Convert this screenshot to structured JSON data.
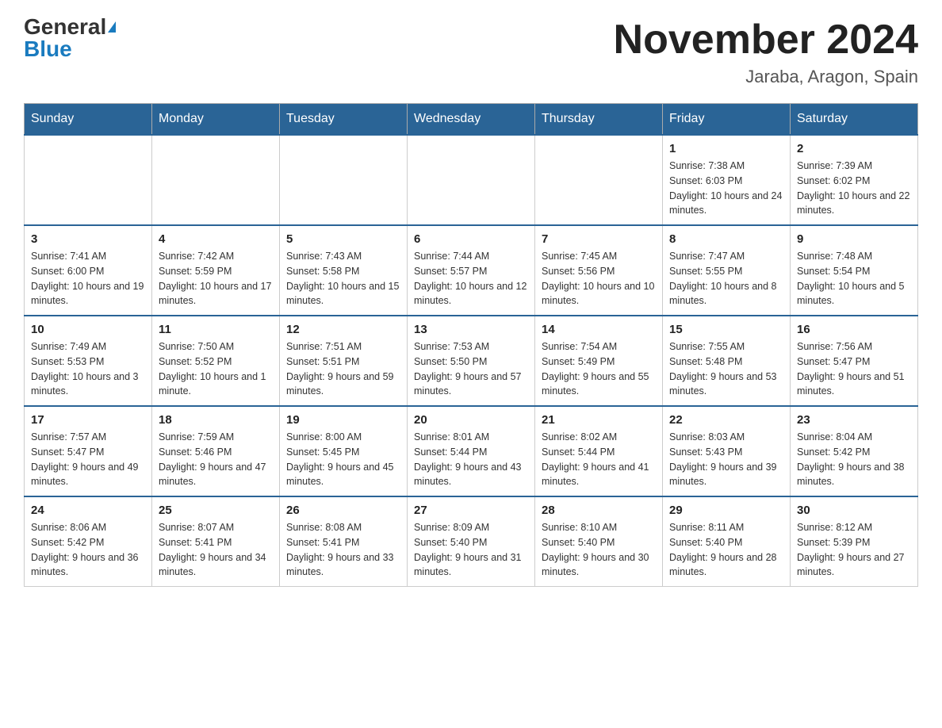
{
  "logo": {
    "general": "General",
    "blue": "Blue"
  },
  "title": "November 2024",
  "subtitle": "Jaraba, Aragon, Spain",
  "days_of_week": [
    "Sunday",
    "Monday",
    "Tuesday",
    "Wednesday",
    "Thursday",
    "Friday",
    "Saturday"
  ],
  "weeks": [
    [
      {
        "day": "",
        "info": ""
      },
      {
        "day": "",
        "info": ""
      },
      {
        "day": "",
        "info": ""
      },
      {
        "day": "",
        "info": ""
      },
      {
        "day": "",
        "info": ""
      },
      {
        "day": "1",
        "info": "Sunrise: 7:38 AM\nSunset: 6:03 PM\nDaylight: 10 hours and 24 minutes."
      },
      {
        "day": "2",
        "info": "Sunrise: 7:39 AM\nSunset: 6:02 PM\nDaylight: 10 hours and 22 minutes."
      }
    ],
    [
      {
        "day": "3",
        "info": "Sunrise: 7:41 AM\nSunset: 6:00 PM\nDaylight: 10 hours and 19 minutes."
      },
      {
        "day": "4",
        "info": "Sunrise: 7:42 AM\nSunset: 5:59 PM\nDaylight: 10 hours and 17 minutes."
      },
      {
        "day": "5",
        "info": "Sunrise: 7:43 AM\nSunset: 5:58 PM\nDaylight: 10 hours and 15 minutes."
      },
      {
        "day": "6",
        "info": "Sunrise: 7:44 AM\nSunset: 5:57 PM\nDaylight: 10 hours and 12 minutes."
      },
      {
        "day": "7",
        "info": "Sunrise: 7:45 AM\nSunset: 5:56 PM\nDaylight: 10 hours and 10 minutes."
      },
      {
        "day": "8",
        "info": "Sunrise: 7:47 AM\nSunset: 5:55 PM\nDaylight: 10 hours and 8 minutes."
      },
      {
        "day": "9",
        "info": "Sunrise: 7:48 AM\nSunset: 5:54 PM\nDaylight: 10 hours and 5 minutes."
      }
    ],
    [
      {
        "day": "10",
        "info": "Sunrise: 7:49 AM\nSunset: 5:53 PM\nDaylight: 10 hours and 3 minutes."
      },
      {
        "day": "11",
        "info": "Sunrise: 7:50 AM\nSunset: 5:52 PM\nDaylight: 10 hours and 1 minute."
      },
      {
        "day": "12",
        "info": "Sunrise: 7:51 AM\nSunset: 5:51 PM\nDaylight: 9 hours and 59 minutes."
      },
      {
        "day": "13",
        "info": "Sunrise: 7:53 AM\nSunset: 5:50 PM\nDaylight: 9 hours and 57 minutes."
      },
      {
        "day": "14",
        "info": "Sunrise: 7:54 AM\nSunset: 5:49 PM\nDaylight: 9 hours and 55 minutes."
      },
      {
        "day": "15",
        "info": "Sunrise: 7:55 AM\nSunset: 5:48 PM\nDaylight: 9 hours and 53 minutes."
      },
      {
        "day": "16",
        "info": "Sunrise: 7:56 AM\nSunset: 5:47 PM\nDaylight: 9 hours and 51 minutes."
      }
    ],
    [
      {
        "day": "17",
        "info": "Sunrise: 7:57 AM\nSunset: 5:47 PM\nDaylight: 9 hours and 49 minutes."
      },
      {
        "day": "18",
        "info": "Sunrise: 7:59 AM\nSunset: 5:46 PM\nDaylight: 9 hours and 47 minutes."
      },
      {
        "day": "19",
        "info": "Sunrise: 8:00 AM\nSunset: 5:45 PM\nDaylight: 9 hours and 45 minutes."
      },
      {
        "day": "20",
        "info": "Sunrise: 8:01 AM\nSunset: 5:44 PM\nDaylight: 9 hours and 43 minutes."
      },
      {
        "day": "21",
        "info": "Sunrise: 8:02 AM\nSunset: 5:44 PM\nDaylight: 9 hours and 41 minutes."
      },
      {
        "day": "22",
        "info": "Sunrise: 8:03 AM\nSunset: 5:43 PM\nDaylight: 9 hours and 39 minutes."
      },
      {
        "day": "23",
        "info": "Sunrise: 8:04 AM\nSunset: 5:42 PM\nDaylight: 9 hours and 38 minutes."
      }
    ],
    [
      {
        "day": "24",
        "info": "Sunrise: 8:06 AM\nSunset: 5:42 PM\nDaylight: 9 hours and 36 minutes."
      },
      {
        "day": "25",
        "info": "Sunrise: 8:07 AM\nSunset: 5:41 PM\nDaylight: 9 hours and 34 minutes."
      },
      {
        "day": "26",
        "info": "Sunrise: 8:08 AM\nSunset: 5:41 PM\nDaylight: 9 hours and 33 minutes."
      },
      {
        "day": "27",
        "info": "Sunrise: 8:09 AM\nSunset: 5:40 PM\nDaylight: 9 hours and 31 minutes."
      },
      {
        "day": "28",
        "info": "Sunrise: 8:10 AM\nSunset: 5:40 PM\nDaylight: 9 hours and 30 minutes."
      },
      {
        "day": "29",
        "info": "Sunrise: 8:11 AM\nSunset: 5:40 PM\nDaylight: 9 hours and 28 minutes."
      },
      {
        "day": "30",
        "info": "Sunrise: 8:12 AM\nSunset: 5:39 PM\nDaylight: 9 hours and 27 minutes."
      }
    ]
  ]
}
